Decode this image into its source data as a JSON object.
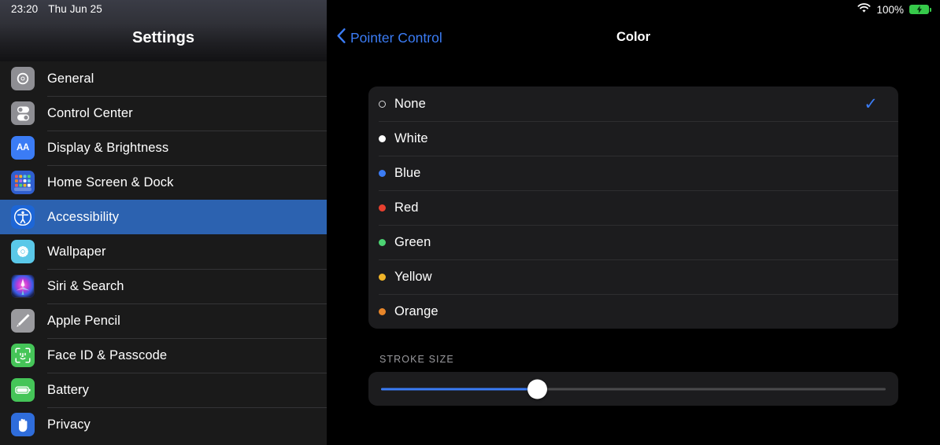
{
  "status_bar": {
    "time": "23:20",
    "date": "Thu Jun 25",
    "battery_percent": "100%",
    "wifi_icon": "wifi-icon",
    "battery_icon": "battery-charging-icon"
  },
  "sidebar": {
    "title": "Settings",
    "selected_item": "Accessibility",
    "items": [
      {
        "label": "General",
        "icon": "gear-icon",
        "icon_bg": "#8e8e93"
      },
      {
        "label": "Control Center",
        "icon": "toggles-icon",
        "icon_bg": "#8e8e93"
      },
      {
        "label": "Display & Brightness",
        "icon": "aa-text-icon",
        "icon_bg": "#3b7cf5"
      },
      {
        "label": "Home Screen & Dock",
        "icon": "app-grid-icon",
        "icon_bg": "#2f5fd0"
      },
      {
        "label": "Accessibility",
        "icon": "accessibility-icon",
        "icon_bg": "#1d66d6"
      },
      {
        "label": "Wallpaper",
        "icon": "flower-icon",
        "icon_bg": "#5ac8e8"
      },
      {
        "label": "Siri & Search",
        "icon": "siri-icon",
        "icon_bg": "#2a2a3a"
      },
      {
        "label": "Apple Pencil",
        "icon": "pencil-icon",
        "icon_bg": "#9a9a9e"
      },
      {
        "label": "Face ID & Passcode",
        "icon": "face-id-icon",
        "icon_bg": "#45c558"
      },
      {
        "label": "Battery",
        "icon": "battery-icon",
        "icon_bg": "#45c558"
      },
      {
        "label": "Privacy",
        "icon": "hand-icon",
        "icon_bg": "#2f6ddb"
      }
    ]
  },
  "nav": {
    "back_label": "Pointer Control",
    "back_icon": "chevron-left-icon",
    "title": "Color"
  },
  "color_list": {
    "selected": "None",
    "checkmark_color": "#3b7cf5",
    "options": [
      {
        "label": "None",
        "dot": "none",
        "dot_color": "transparent",
        "selected": true
      },
      {
        "label": "White",
        "dot": "filled",
        "dot_color": "#ffffff",
        "selected": false
      },
      {
        "label": "Blue",
        "dot": "filled",
        "dot_color": "#3b7cf5",
        "selected": false
      },
      {
        "label": "Red",
        "dot": "filled",
        "dot_color": "#e8402f",
        "selected": false
      },
      {
        "label": "Green",
        "dot": "filled",
        "dot_color": "#4cd373",
        "selected": false
      },
      {
        "label": "Yellow",
        "dot": "filled",
        "dot_color": "#f0b429",
        "selected": false
      },
      {
        "label": "Orange",
        "dot": "filled",
        "dot_color": "#e8862a",
        "selected": false
      }
    ]
  },
  "stroke_size": {
    "header": "STROKE SIZE",
    "value_percent": 31,
    "fill_color": "#3b7cf5",
    "track_color": "#4a4a4c"
  }
}
